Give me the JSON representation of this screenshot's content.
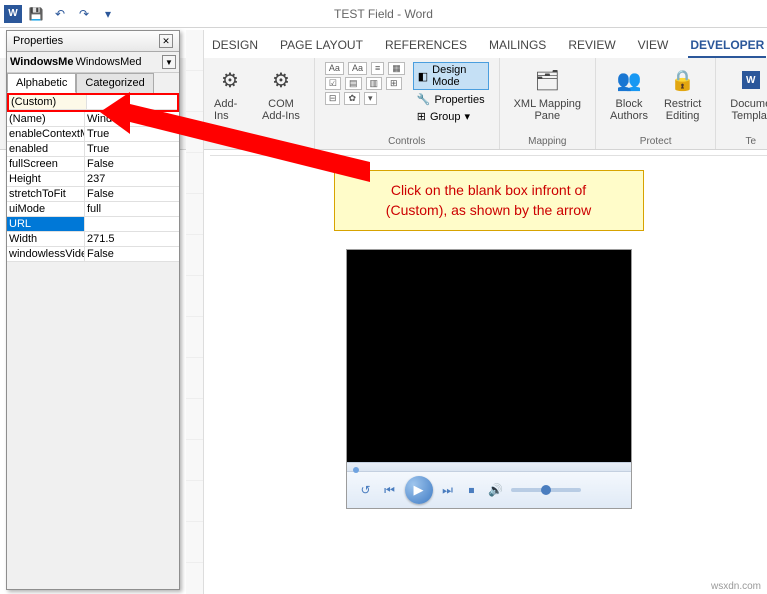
{
  "titlebar": {
    "doc_title": "TEST Field - Word"
  },
  "qat": {
    "save": "💾",
    "undo": "↶",
    "redo": "↷",
    "dd": "▾"
  },
  "properties": {
    "title": "Properties",
    "object_name": "WindowsMe",
    "object_type": "WindowsMed",
    "tabs": {
      "alphabetic": "Alphabetic",
      "categorized": "Categorized"
    },
    "rows": [
      {
        "name": "(Custom)",
        "value": ""
      },
      {
        "name": "(Name)",
        "value": "WindowsMedia"
      },
      {
        "name": "enableContextM",
        "value": "True"
      },
      {
        "name": "enabled",
        "value": "True"
      },
      {
        "name": "fullScreen",
        "value": "False"
      },
      {
        "name": "Height",
        "value": "237"
      },
      {
        "name": "stretchToFit",
        "value": "False"
      },
      {
        "name": "uiMode",
        "value": "full"
      },
      {
        "name": "URL",
        "value": ""
      },
      {
        "name": "Width",
        "value": "271.5"
      },
      {
        "name": "windowlessVideo",
        "value": "False"
      }
    ]
  },
  "ribbon": {
    "tabs": [
      "DESIGN",
      "PAGE LAYOUT",
      "REFERENCES",
      "MAILINGS",
      "REVIEW",
      "VIEW",
      "DEVELOPER"
    ],
    "active_tab": "DEVELOPER",
    "addins_group": {
      "addins": "Add-Ins",
      "com": "COM\nAdd-Ins",
      "label": "Add-Ins"
    },
    "controls_group": {
      "design_mode": "Design Mode",
      "properties": "Properties",
      "group": "Group",
      "label": "Controls"
    },
    "mapping_group": {
      "xml": "XML Mapping\nPane",
      "label": "Mapping"
    },
    "protect_group": {
      "block": "Block\nAuthors",
      "restrict": "Restrict\nEditing",
      "label": "Protect"
    },
    "template_group": {
      "doc": "Docume\nTemplat",
      "label": "Te"
    }
  },
  "callout": {
    "line1": "Click on the blank box infront of",
    "line2": "(Custom), as shown by the arrow"
  },
  "watermark": "wsxdn.com"
}
